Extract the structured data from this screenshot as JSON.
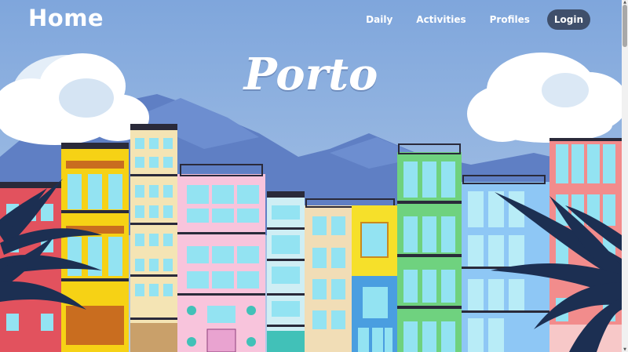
{
  "nav": {
    "logo": "Home",
    "links": [
      "Daily",
      "Activities",
      "Profiles"
    ],
    "login": "Login"
  },
  "hero": {
    "title": "Porto"
  },
  "colors": {
    "sky": "#8fb3de",
    "mountains": "#5f7fc4",
    "cloud": "#ffffff",
    "login_bg": "#3f4f6b",
    "palm": "#1c2f52"
  }
}
